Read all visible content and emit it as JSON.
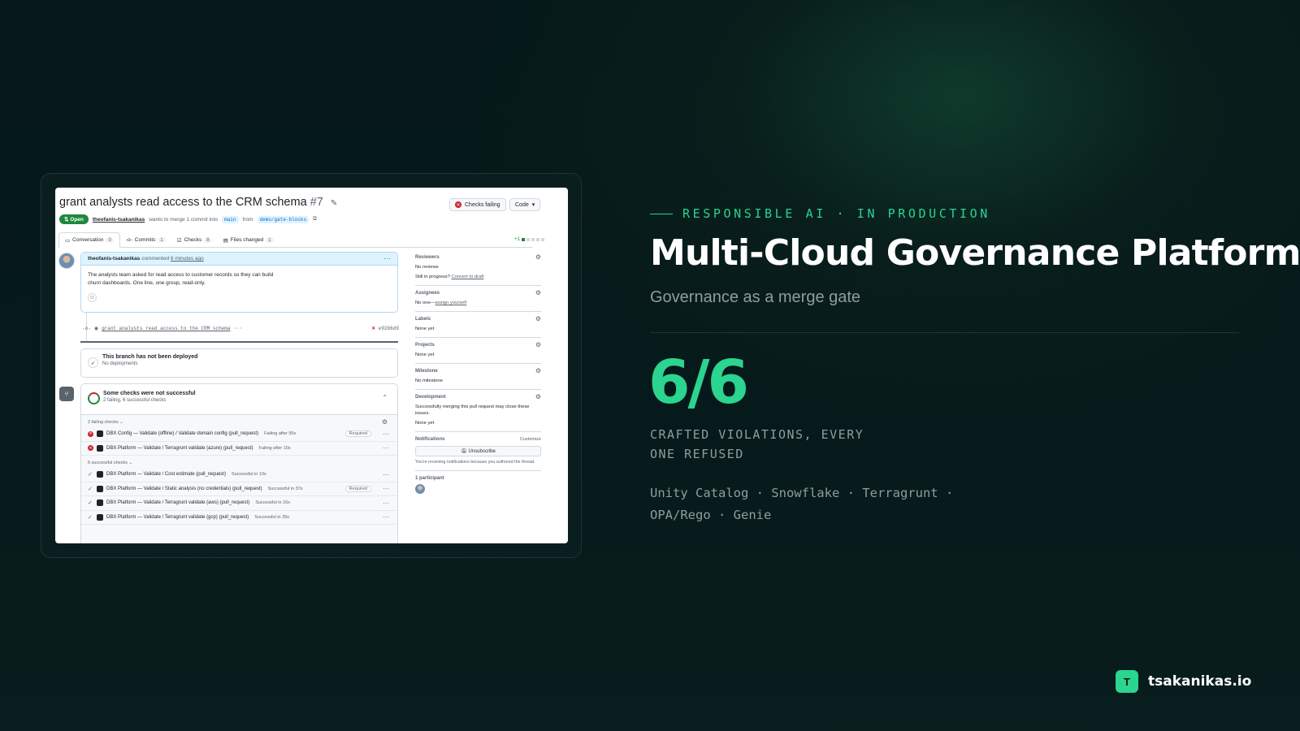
{
  "pr": {
    "title": "grant analysts read access to the CRM schema",
    "number": "#7",
    "checks_button": "Checks failing",
    "code_button": "Code",
    "status_badge": "Open",
    "author": "theofanis-tsakanikas",
    "merge_text": "wants to merge 1 commit into",
    "base_branch": "main",
    "from_text": "from",
    "head_branch": "demo/gate-blocks",
    "diffstat": "+1"
  },
  "tabs": [
    {
      "label": "Conversation",
      "count": "0"
    },
    {
      "label": "Commits",
      "count": "1"
    },
    {
      "label": "Checks",
      "count": "8"
    },
    {
      "label": "Files changed",
      "count": "1"
    }
  ],
  "comment": {
    "author": "theofanis-tsakanikas",
    "verb": "commented",
    "time": "6 minutes ago",
    "body_line1": "The analysts team asked for read access to customer records so they can build",
    "body_line2": "churn dashboards. One line, one group, read-only."
  },
  "commit": {
    "message": "grant analysts read access to the CRM schema",
    "ellipsis": "···",
    "sha": "e9266d9"
  },
  "deploy": {
    "title": "This branch has not been deployed",
    "subtitle": "No deployments"
  },
  "checks": {
    "title": "Some checks were not successful",
    "subtitle": "2 failing, 6 successful checks",
    "failing_label": "2 failing checks",
    "successful_label": "6 successful checks",
    "required_label": "Required",
    "failing": [
      {
        "name": "DBX Config — Validate (offline) / Validate domain config (pull_request)",
        "status": "Failing after 55s",
        "required": true
      },
      {
        "name": "DBX Platform — Validate / Terragrunt validate (azure) (pull_request)",
        "status": "Failing after 10s",
        "required": false
      }
    ],
    "successful": [
      {
        "name": "DBX Platform — Validate / Cost estimate (pull_request)",
        "status": "Successful in 10s",
        "required": false
      },
      {
        "name": "DBX Platform — Validate / Static analysis (no credentials) (pull_request)",
        "status": "Successful in 37s",
        "required": true
      },
      {
        "name": "DBX Platform — Validate / Terragrunt validate (aws) (pull_request)",
        "status": "Successful in 16s",
        "required": false
      },
      {
        "name": "DBX Platform — Validate / Terragrunt validate (gcp) (pull_request)",
        "status": "Successful in 35s",
        "required": false
      }
    ]
  },
  "sidebar": {
    "reviewers_h": "Reviewers",
    "reviewers_v": "No reviews",
    "reviewers_v2": "Still in progress?",
    "reviewers_link": "Convert to draft",
    "assignees_h": "Assignees",
    "assignees_v": "No one—",
    "assignees_link": "assign yourself",
    "labels_h": "Labels",
    "labels_v": "None yet",
    "projects_h": "Projects",
    "projects_v": "None yet",
    "milestone_h": "Milestone",
    "milestone_v": "No milestone",
    "development_h": "Development",
    "development_v": "Successfully merging this pull request may close these issues.",
    "development_v2": "None yet",
    "notifications_h": "Notifications",
    "customize": "Customize",
    "unsubscribe": "Unsubscribe",
    "notif_text": "You're receiving notifications because you authored the thread.",
    "participants": "1 participant"
  },
  "hero": {
    "eyebrow": "RESPONSIBLE AI · IN PRODUCTION",
    "title": "Multi-Cloud Governance Platform",
    "subtitle": "Governance as a merge gate",
    "stat": "6/6",
    "stat_label_line1": "CRAFTED VIOLATIONS, EVERY",
    "stat_label_line2": "ONE REFUSED",
    "tech_line1": "Unity Catalog · Snowflake · Terragrunt ·",
    "tech_line2": "OPA/Rego · Genie"
  },
  "brand": {
    "logo_letter": "T",
    "name": "tsakanikas.io"
  },
  "colors": {
    "accent": "#2bd48f",
    "background": "#06181a",
    "muted": "#8e9e9c",
    "github_green": "#1f883d",
    "github_red": "#cf222e"
  }
}
